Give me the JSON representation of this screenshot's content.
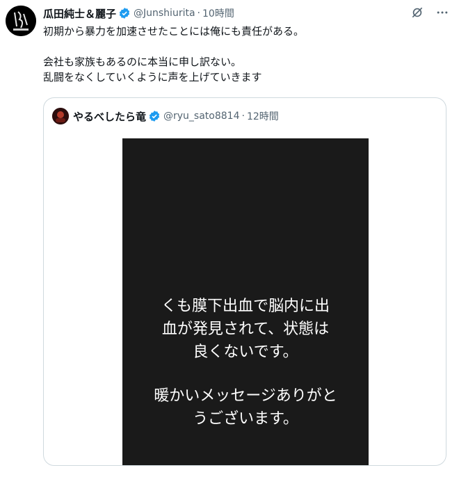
{
  "tweet": {
    "author_name": "瓜田純士＆麗子",
    "handle": "@Junshiurita",
    "separator": "·",
    "time": "10時間",
    "lines": [
      "初期から暴力を加速させたことには俺にも責任がある。",
      "",
      "会社も家族もあるのに本当に申し訳ない。",
      "乱闘をなくしていくように声を上げていきます"
    ],
    "icons": {
      "verified": "verified-badge-icon",
      "grok": "grok-icon",
      "more": "more-icon"
    }
  },
  "quote": {
    "author_name": "やるべしたら竜",
    "handle": "@ryu_sato8814",
    "separator": "·",
    "time": "12時間",
    "media_text": [
      "くも膜下出血で脳内に出",
      "血が発見されて、状態は",
      "良くないです。",
      "",
      "暖かいメッセージありがと",
      "うございます。"
    ]
  },
  "colors": {
    "verified": "#1d9bf0",
    "secondary_text": "#536471",
    "border": "#cfd9de",
    "media_bg": "#1a1a1a"
  }
}
